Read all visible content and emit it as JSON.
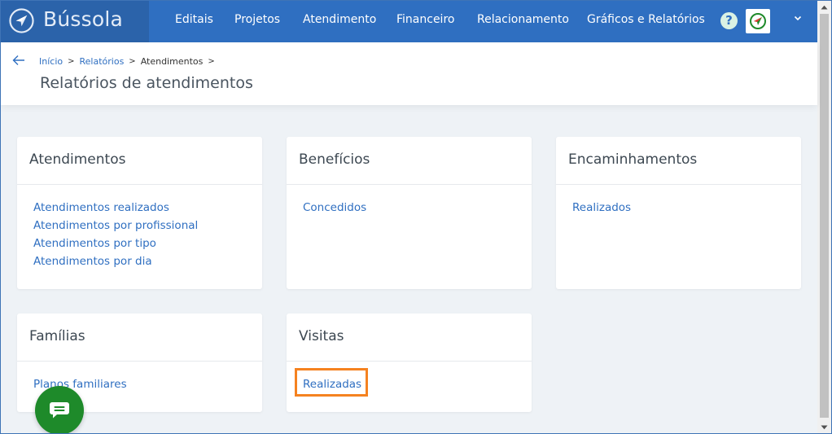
{
  "brand": {
    "name": "Bússola"
  },
  "nav": {
    "items": [
      {
        "label": "Editais"
      },
      {
        "label": "Projetos"
      },
      {
        "label": "Atendimento"
      },
      {
        "label": "Financeiro"
      },
      {
        "label": "Relacionamento"
      },
      {
        "label": "Gráficos e Relatórios"
      }
    ],
    "help_label": "?"
  },
  "breadcrumb": {
    "items": [
      {
        "label": "Início"
      },
      {
        "label": "Relatórios"
      },
      {
        "label": "Atendimentos"
      }
    ],
    "separator": ">"
  },
  "page": {
    "title": "Relatórios de atendimentos"
  },
  "cards": [
    {
      "title": "Atendimentos",
      "links": [
        "Atendimentos realizados",
        "Atendimentos por profissional",
        "Atendimentos por tipo",
        "Atendimentos por dia"
      ]
    },
    {
      "title": "Benefícios",
      "links": [
        "Concedidos"
      ]
    },
    {
      "title": "Encaminhamentos",
      "links": [
        "Realizados"
      ]
    },
    {
      "title": "Famílias",
      "links": [
        "Planos familiares"
      ]
    },
    {
      "title": "Visitas",
      "links": [
        "Realizadas"
      ]
    }
  ],
  "colors": {
    "navbar": "#2f6fc1",
    "brand_bg": "#2b63aa",
    "link": "#2f6fc1",
    "highlight": "#f58220",
    "chat": "#1e8a2a"
  },
  "icons": {
    "brand": "compass-logo-icon",
    "help": "question-icon",
    "avatar": "compass-avatar-icon",
    "menu": "chevron-down-icon",
    "back": "arrow-left-icon",
    "chat": "chat-icon"
  }
}
